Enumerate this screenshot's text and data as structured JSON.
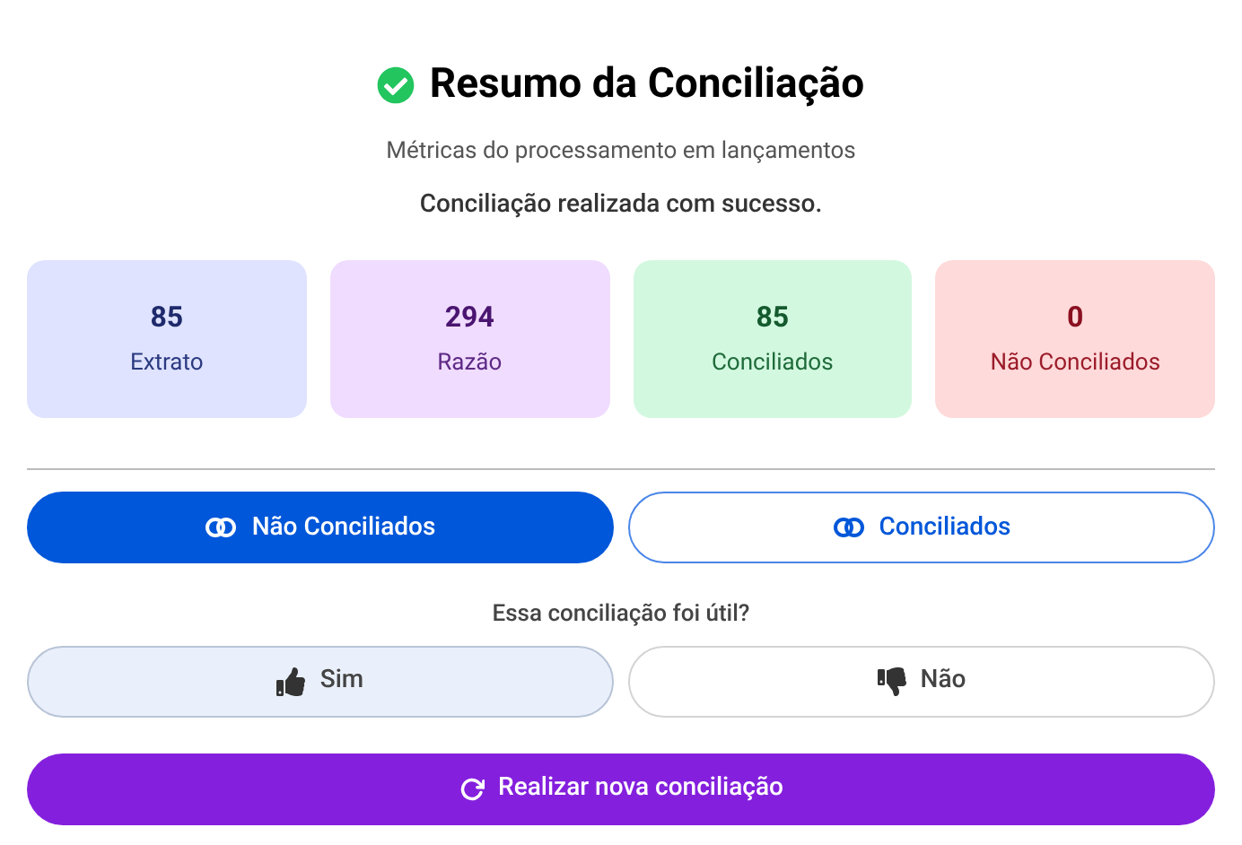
{
  "header": {
    "title": "Resumo da Conciliação",
    "subtitle": "Métricas do processamento em lançamentos",
    "message": "Conciliação realizada com sucesso."
  },
  "metrics": [
    {
      "value": "85",
      "label": "Extrato",
      "kind": "blue"
    },
    {
      "value": "294",
      "label": "Razão",
      "kind": "purple"
    },
    {
      "value": "85",
      "label": "Conciliados",
      "kind": "green"
    },
    {
      "value": "0",
      "label": "Não Conciliados",
      "kind": "red"
    }
  ],
  "tabs": [
    {
      "label": "Não Conciliados",
      "selected": true
    },
    {
      "label": "Conciliados",
      "selected": false
    }
  ],
  "feedback": {
    "question": "Essa conciliação foi útil?",
    "options": [
      {
        "label": "Sim",
        "kind": "up",
        "selected": true
      },
      {
        "label": "Não",
        "kind": "down",
        "selected": false
      }
    ]
  },
  "action": {
    "label": "Realizar nova conciliação"
  }
}
